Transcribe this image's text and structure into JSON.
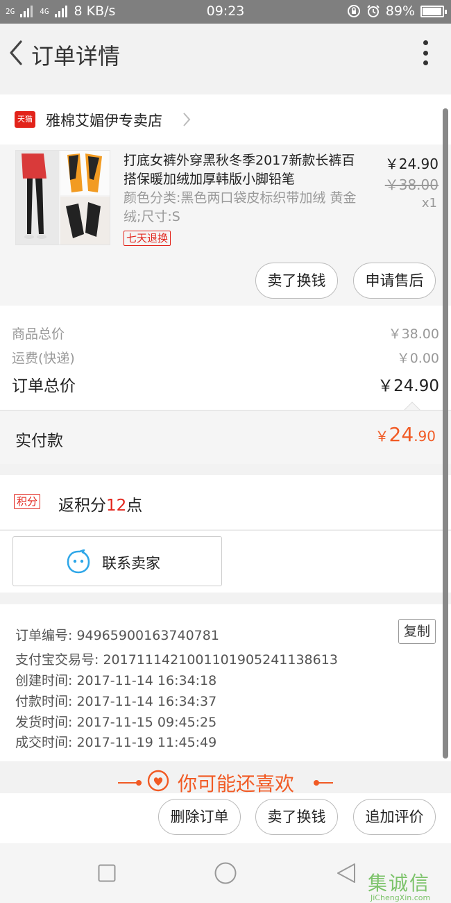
{
  "status_bar": {
    "signal_left": "2G",
    "signal_right": "4G",
    "speed": "8 KB/s",
    "time": "09:23",
    "battery": "89%",
    "battery_level": 0.89
  },
  "header": {
    "title": "订单详情"
  },
  "store": {
    "badge": "天猫",
    "name": "雅棉艾媚伊专卖店"
  },
  "product": {
    "title": "打底女裤外穿黑秋冬季2017新款长裤百搭保暖加绒加厚韩版小脚铅笔",
    "sku": "颜色分类:黑色两口袋皮标织带加绒 黄金绒;尺寸:S",
    "tag": "七天退换",
    "price": "￥24.90",
    "original_price": "￥38.00",
    "quantity": "x1",
    "buttons": {
      "resell": "卖了换钱",
      "after_sale": "申请售后"
    }
  },
  "summary": {
    "goods_total_label": "商品总价",
    "goods_total_value": "￥38.00",
    "shipping_label": "运费(快递)",
    "shipping_value": "￥0.00",
    "order_total_label": "订单总价",
    "order_total_value": "￥24.90"
  },
  "paid": {
    "label": "实付款",
    "currency": "￥",
    "integer": "24",
    "decimal": ".90"
  },
  "points": {
    "tag": "积分",
    "prefix": "返积分",
    "count": "12",
    "suffix": "点"
  },
  "contact": {
    "label": "联系卖家"
  },
  "order_info": {
    "copy_label": "复制",
    "lines": [
      "订单编号: 94965900163740781",
      "支付宝交易号: 2017111421001101905241138613",
      "创建时间: 2017-11-14 16:34:18",
      "付款时间: 2017-11-14 16:34:37",
      "发货时间: 2017-11-15 09:45:25",
      "成交时间: 2017-11-19 11:45:49"
    ]
  },
  "recommend": {
    "title": "你可能还喜欢"
  },
  "actions": {
    "delete": "删除订单",
    "resell": "卖了换钱",
    "review": "追加评价"
  },
  "watermark": {
    "main": "集诚信",
    "sub": "JiChengXin.com"
  },
  "colors": {
    "accent_orange": "#f15a24",
    "tmall_red": "#e2231a",
    "contact_blue": "#2fa7e8"
  },
  "icons": [
    "back-arrow-icon",
    "more-vertical-icon",
    "tmall-icon",
    "chevron-right-icon",
    "contact-seller-icon",
    "heart-icon",
    "square-nav-icon",
    "circle-nav-icon",
    "triangle-back-nav-icon"
  ]
}
